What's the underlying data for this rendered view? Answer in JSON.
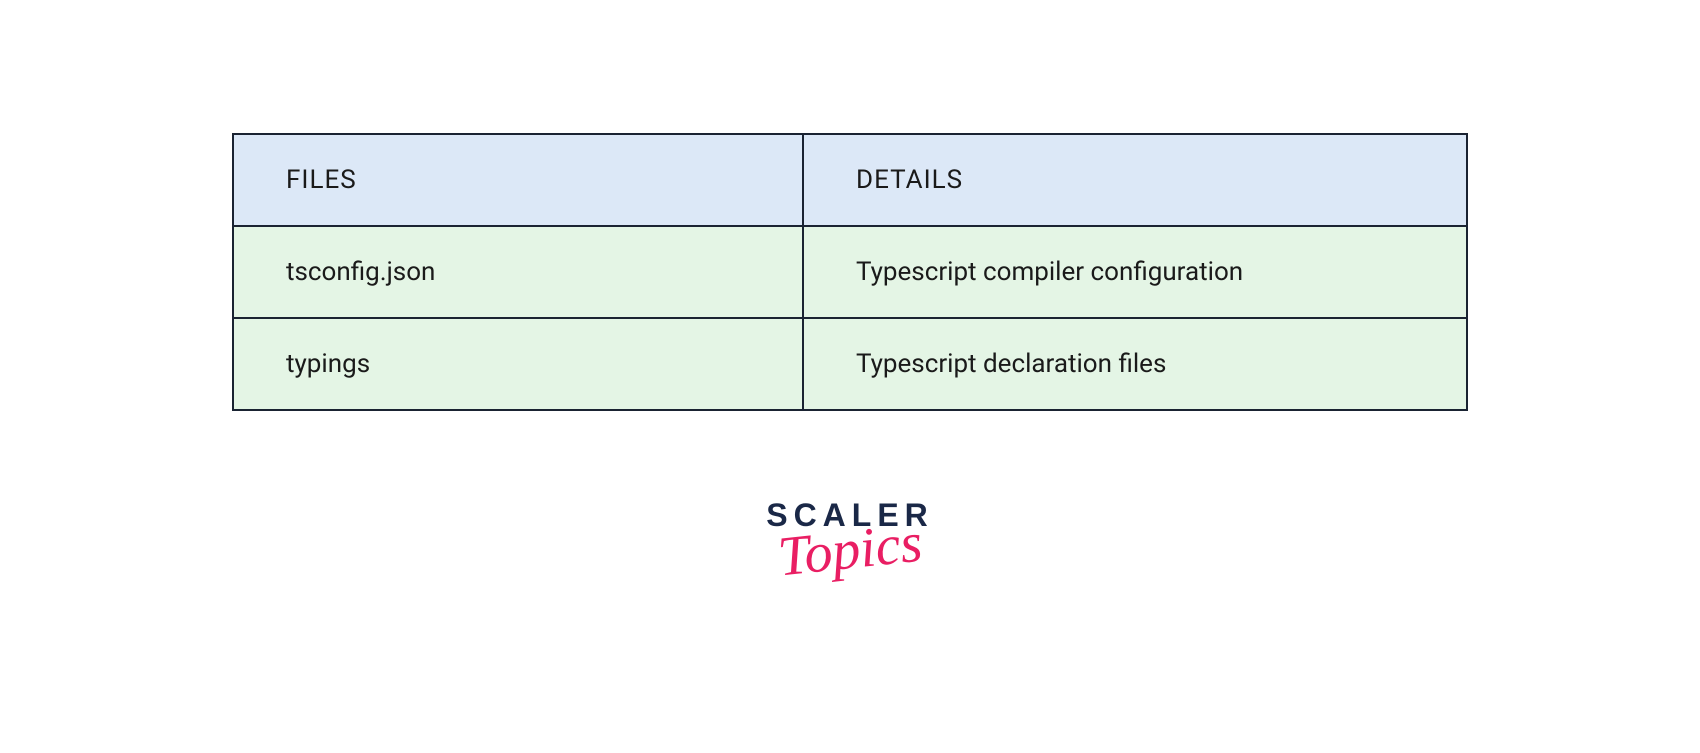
{
  "table": {
    "headers": {
      "files": "FILES",
      "details": "DETAILS"
    },
    "rows": [
      {
        "files": "tsconfig.json",
        "details": "Typescript compiler configuration"
      },
      {
        "files": "typings",
        "details": "Typescript declaration files"
      }
    ]
  },
  "logo": {
    "scaler": "SCALER",
    "topics": "Topics"
  }
}
